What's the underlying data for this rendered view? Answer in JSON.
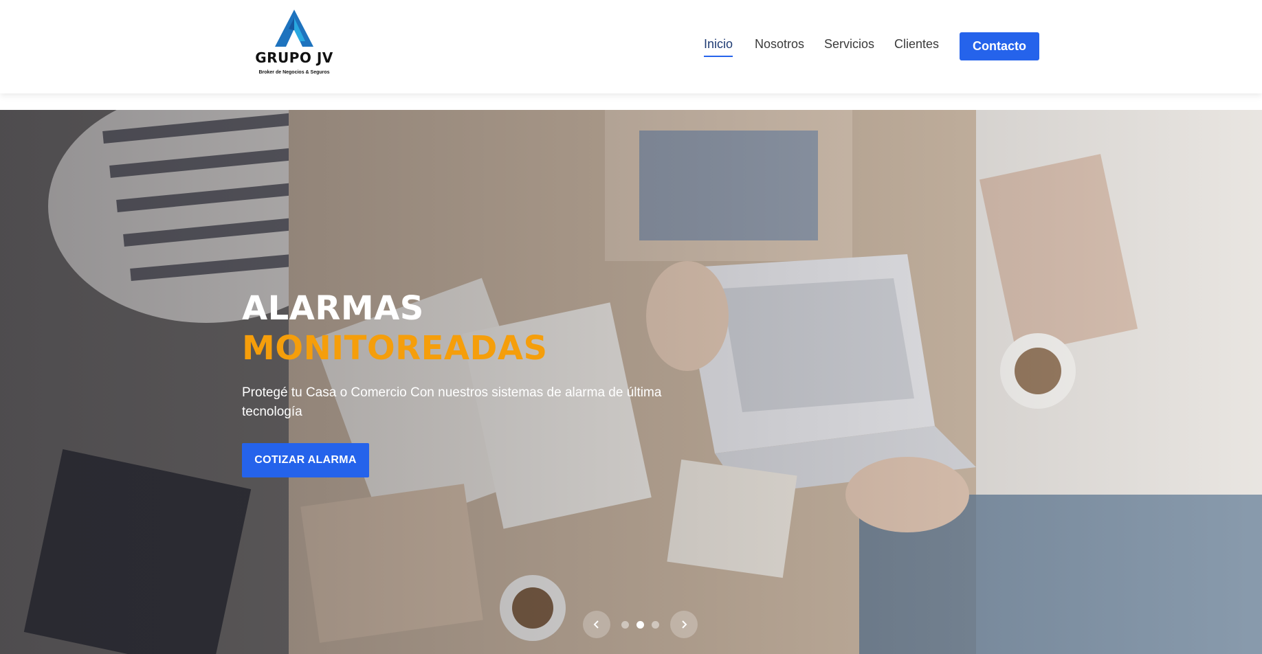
{
  "brand": {
    "name": "GRUPO JV",
    "tagline": "Broker de Negocios & Seguros",
    "logo_colors": [
      "#1e73be",
      "#29a8e0"
    ]
  },
  "nav": {
    "items": [
      {
        "label": "Inicio",
        "active": true
      },
      {
        "label": "Nosotros",
        "active": false
      },
      {
        "label": "Servicios",
        "active": false
      },
      {
        "label": "Clientes",
        "active": false
      }
    ],
    "contact_label": "Contacto"
  },
  "hero": {
    "title_line1": "ALARMAS",
    "title_line2": "MONITOREADAS",
    "description": "Protegé tu Casa o Comercio Con nuestros sistemas de alarma de última tecnología",
    "cta_label": "COTIZAR ALARMA",
    "slides_count": 3,
    "active_slide": 2
  },
  "icons": {
    "prev": "chevron-left-icon",
    "next": "chevron-right-icon"
  },
  "colors": {
    "primary": "#2563eb",
    "accent": "#f59e0b",
    "nav_text": "#3a3a3a"
  }
}
